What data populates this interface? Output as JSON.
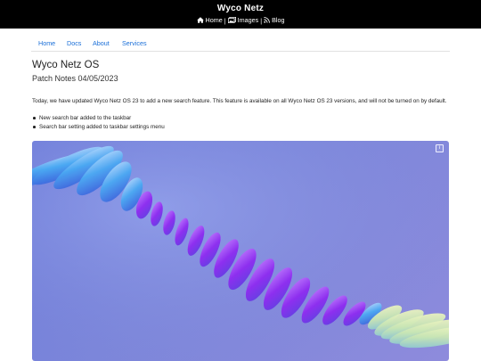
{
  "header": {
    "site_title": "Wyco Netz",
    "links": [
      {
        "label": "Home",
        "icon": "home-icon"
      },
      {
        "label": "Images",
        "icon": "images-icon"
      },
      {
        "label": "Blog",
        "icon": "rss-icon"
      }
    ],
    "separator": "|"
  },
  "nav": {
    "items": [
      {
        "label": "Home"
      },
      {
        "label": "Docs"
      },
      {
        "label": "About"
      },
      {
        "label": "Services"
      }
    ]
  },
  "article": {
    "title": "Wyco Netz OS",
    "subtitle": "Patch Notes 04/05/2023",
    "intro": "Today, we have updated Wyco Netz OS 23 to add a new search feature. This feature is available on all Wyco Netz OS 23 versions, and will not be turned on by default.",
    "bullets": [
      "New search bar added to the taskbar",
      "Search bar setting added to taskbar settings menu"
    ]
  },
  "wallpaper": {
    "info_icon_label": "i",
    "info_icon": "info-icon",
    "colors": {
      "background": "#7b84d9",
      "ribbon_purple": "#8f2cf0",
      "ribbon_blue": "#5aa9f0",
      "ribbon_yellow": "#e9ec9c"
    }
  }
}
